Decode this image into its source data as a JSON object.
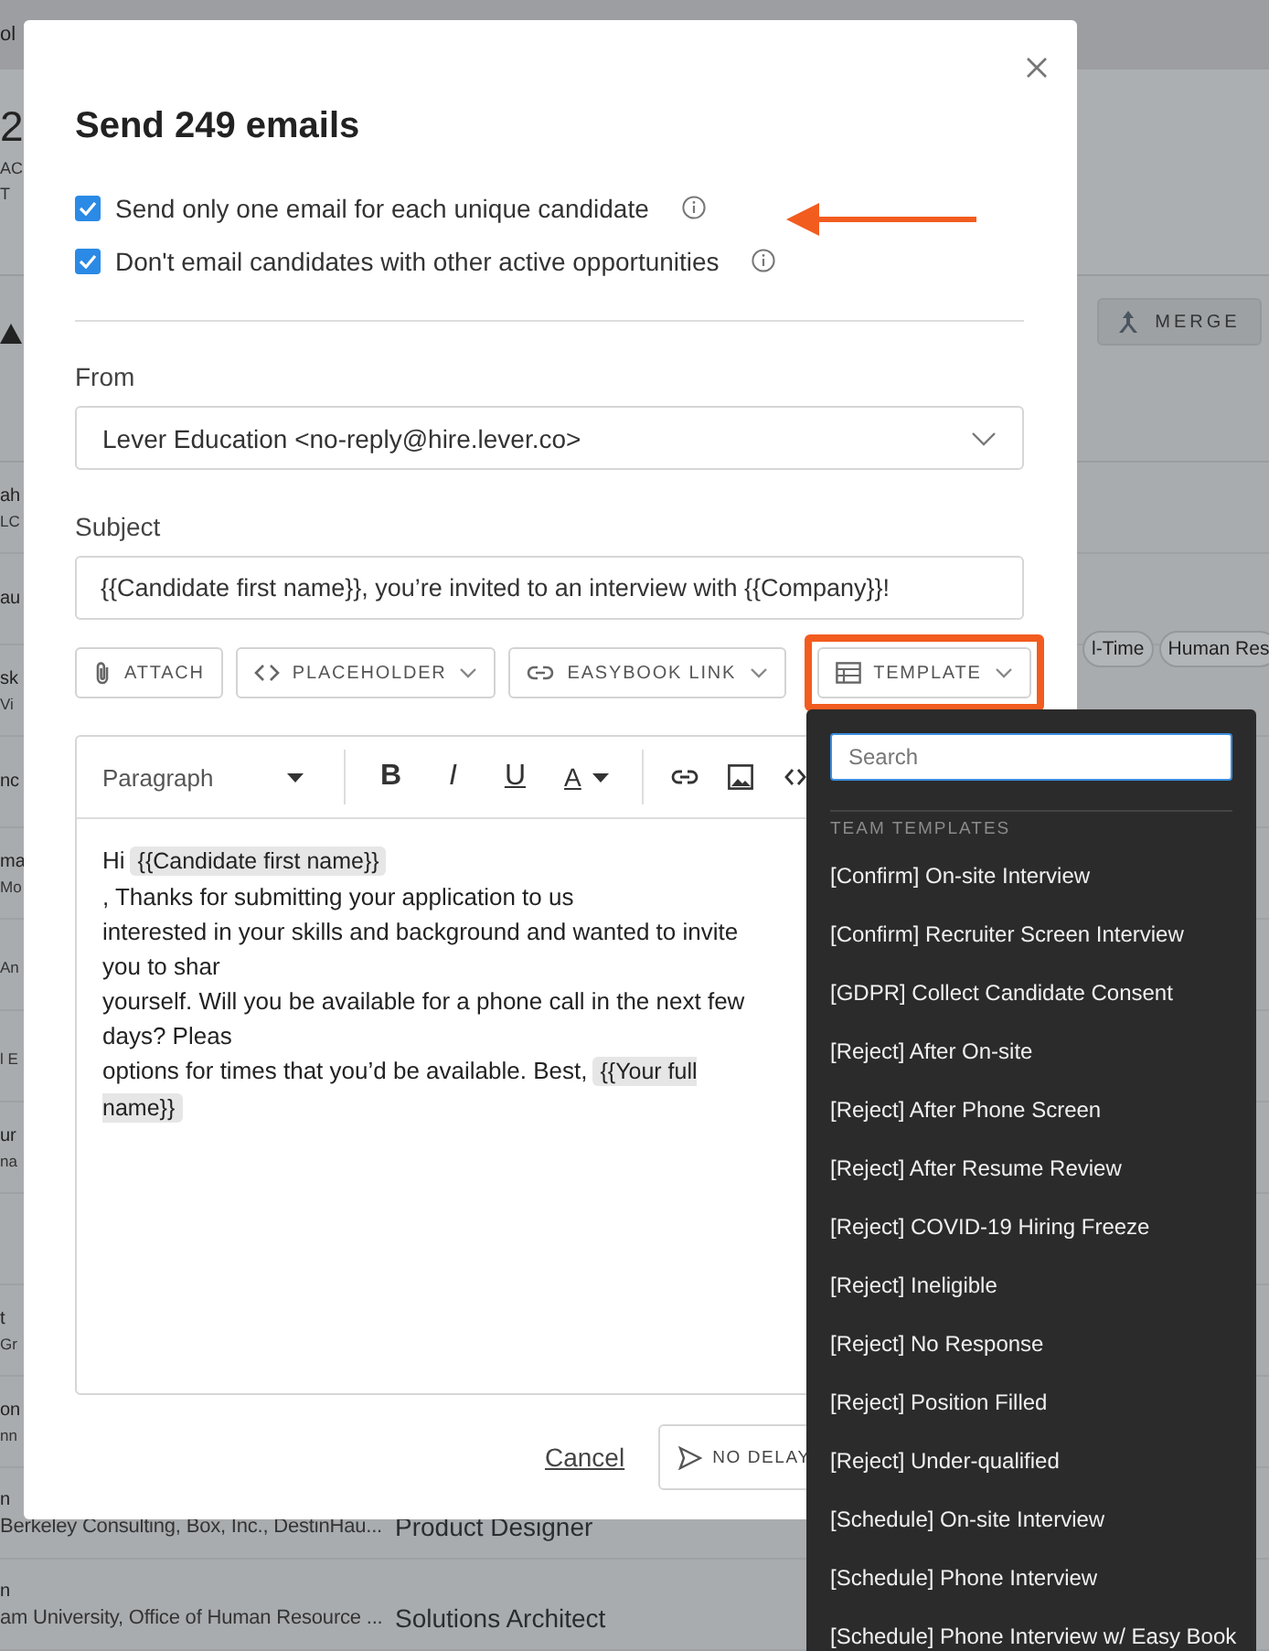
{
  "background": {
    "title_fragment": "ol",
    "header": [
      "2",
      "AC",
      "T"
    ],
    "merge_button": "MERGE",
    "rows": [
      {
        "name": "ah",
        "detail": "LC"
      },
      {
        "name": "au"
      },
      {
        "name": "sk",
        "detail": "Vi",
        "tags": [
          "l-Time",
          "Human Res"
        ]
      },
      {
        "name": "nc"
      },
      {
        "name": "ma",
        "detail": "Mo"
      },
      {
        "detail": "An"
      },
      {
        "detail": "l E"
      },
      {
        "name": "ur",
        "detail": "na"
      },
      {},
      {
        "name": "t",
        "detail": "Gr"
      },
      {
        "name": "on",
        "detail": "nn"
      },
      {
        "name": "n",
        "detail": "Berkeley Consulting, Box, Inc., DestinHau...",
        "role": "Product Designer"
      },
      {
        "name": "n",
        "detail": "am University, Office of Human Resource ...",
        "role": "Solutions Architect"
      }
    ]
  },
  "modal": {
    "title": "Send 249 emails",
    "options": [
      {
        "label": "Send only one email for each unique candidate",
        "checked": true
      },
      {
        "label": "Don't email candidates with other active opportunities",
        "checked": true
      }
    ],
    "callout_arrow": true,
    "from": {
      "label": "From",
      "value": "Lever Education <no-reply@hire.lever.co>"
    },
    "subject": {
      "label": "Subject",
      "value": "{{Candidate first name}}, you’re invited to an interview with {{Company}}!"
    },
    "insert_buttons": [
      {
        "kind": "attach",
        "label": "ATTACH",
        "dropdown": false,
        "highlighted": false
      },
      {
        "kind": "placeholder",
        "label": "PLACEHOLDER",
        "dropdown": true,
        "highlighted": false
      },
      {
        "kind": "link",
        "label": "EASYBOOK LINK",
        "dropdown": true,
        "highlighted": false
      },
      {
        "kind": "template",
        "label": "TEMPLATE",
        "dropdown": true,
        "highlighted": true
      }
    ],
    "editor": {
      "block_style": "Paragraph",
      "format_buttons": [
        {
          "kind": "bold",
          "label": "B"
        },
        {
          "kind": "italic",
          "label": "I"
        },
        {
          "kind": "underline",
          "label": "U"
        },
        {
          "kind": "color",
          "label": "A"
        }
      ],
      "body_lines": [
        [
          {
            "kind": "text",
            "text": "Hi"
          },
          {
            "kind": "chip",
            "text": "{{Candidate first name}}"
          },
          {
            "kind": "text",
            "text": ", Thanks for submitting your application to us"
          }
        ],
        [
          {
            "kind": "text",
            "text": "interested in your skills and background and wanted to invite you to shar"
          }
        ],
        [
          {
            "kind": "text",
            "text": "yourself. Will you be available for a phone call in the next few days? Pleas"
          }
        ],
        [
          {
            "kind": "text",
            "text": "options for times that you’d be available. Best,"
          },
          {
            "kind": "chip",
            "text": "{{Your full name}}"
          }
        ]
      ]
    },
    "cancel": "Cancel",
    "send_button": "NO DELAY"
  },
  "template_menu": {
    "placeholder": "Search",
    "section": "TEAM TEMPLATES",
    "items": [
      "[Confirm] On-site Interview",
      "[Confirm] Recruiter Screen Interview",
      "[GDPR] Collect Candidate Consent",
      "[Reject] After On-site",
      "[Reject] After Phone Screen",
      "[Reject] After Resume Review",
      "[Reject] COVID-19 Hiring Freeze",
      "[Reject] Ineligible",
      "[Reject] No Response",
      "[Reject] Position Filled",
      "[Reject] Under-qualified",
      "[Schedule] On-site Interview",
      "[Schedule] Phone Interview",
      "[Schedule] Phone Interview w/ Easy Book"
    ]
  }
}
